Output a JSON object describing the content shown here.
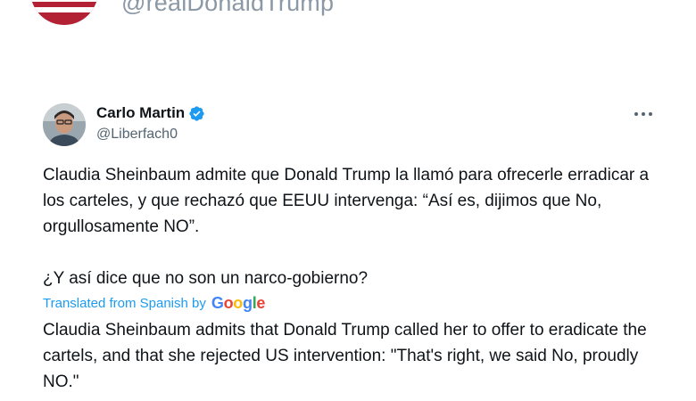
{
  "shared_by": {
    "handle": "@realDonaldTrump",
    "avatar_icon": "avatar-flag-portrait"
  },
  "tweet": {
    "author_name": "Carlo Martin",
    "author_handle": "@Liberfach0",
    "verified_icon": "verified-badge-icon",
    "verified_color": "#1d9bf0",
    "more_icon": "more-horizontal-icon",
    "text_paragraph_1": "Claudia Sheinbaum admite que Donald Trump la llamó para ofrecerle erradicar a los carteles, y que rechazó que EEUU intervenga: “Así es, dijimos que No, orgullosamente NO”.",
    "text_paragraph_2": "¿Y así dice que no son un narco-gobierno?",
    "translation_label": "Translated from Spanish by",
    "translation_provider": "Google",
    "translated_text": "Claudia Sheinbaum admits that Donald Trump called her to offer to eradicate the cartels, and that she rejected US intervention: \"That's right, we said No, proudly NO.\""
  },
  "colors": {
    "link_blue": "#1d9bf0",
    "secondary_text": "#536471",
    "faded_handle": "#8b98a5"
  }
}
